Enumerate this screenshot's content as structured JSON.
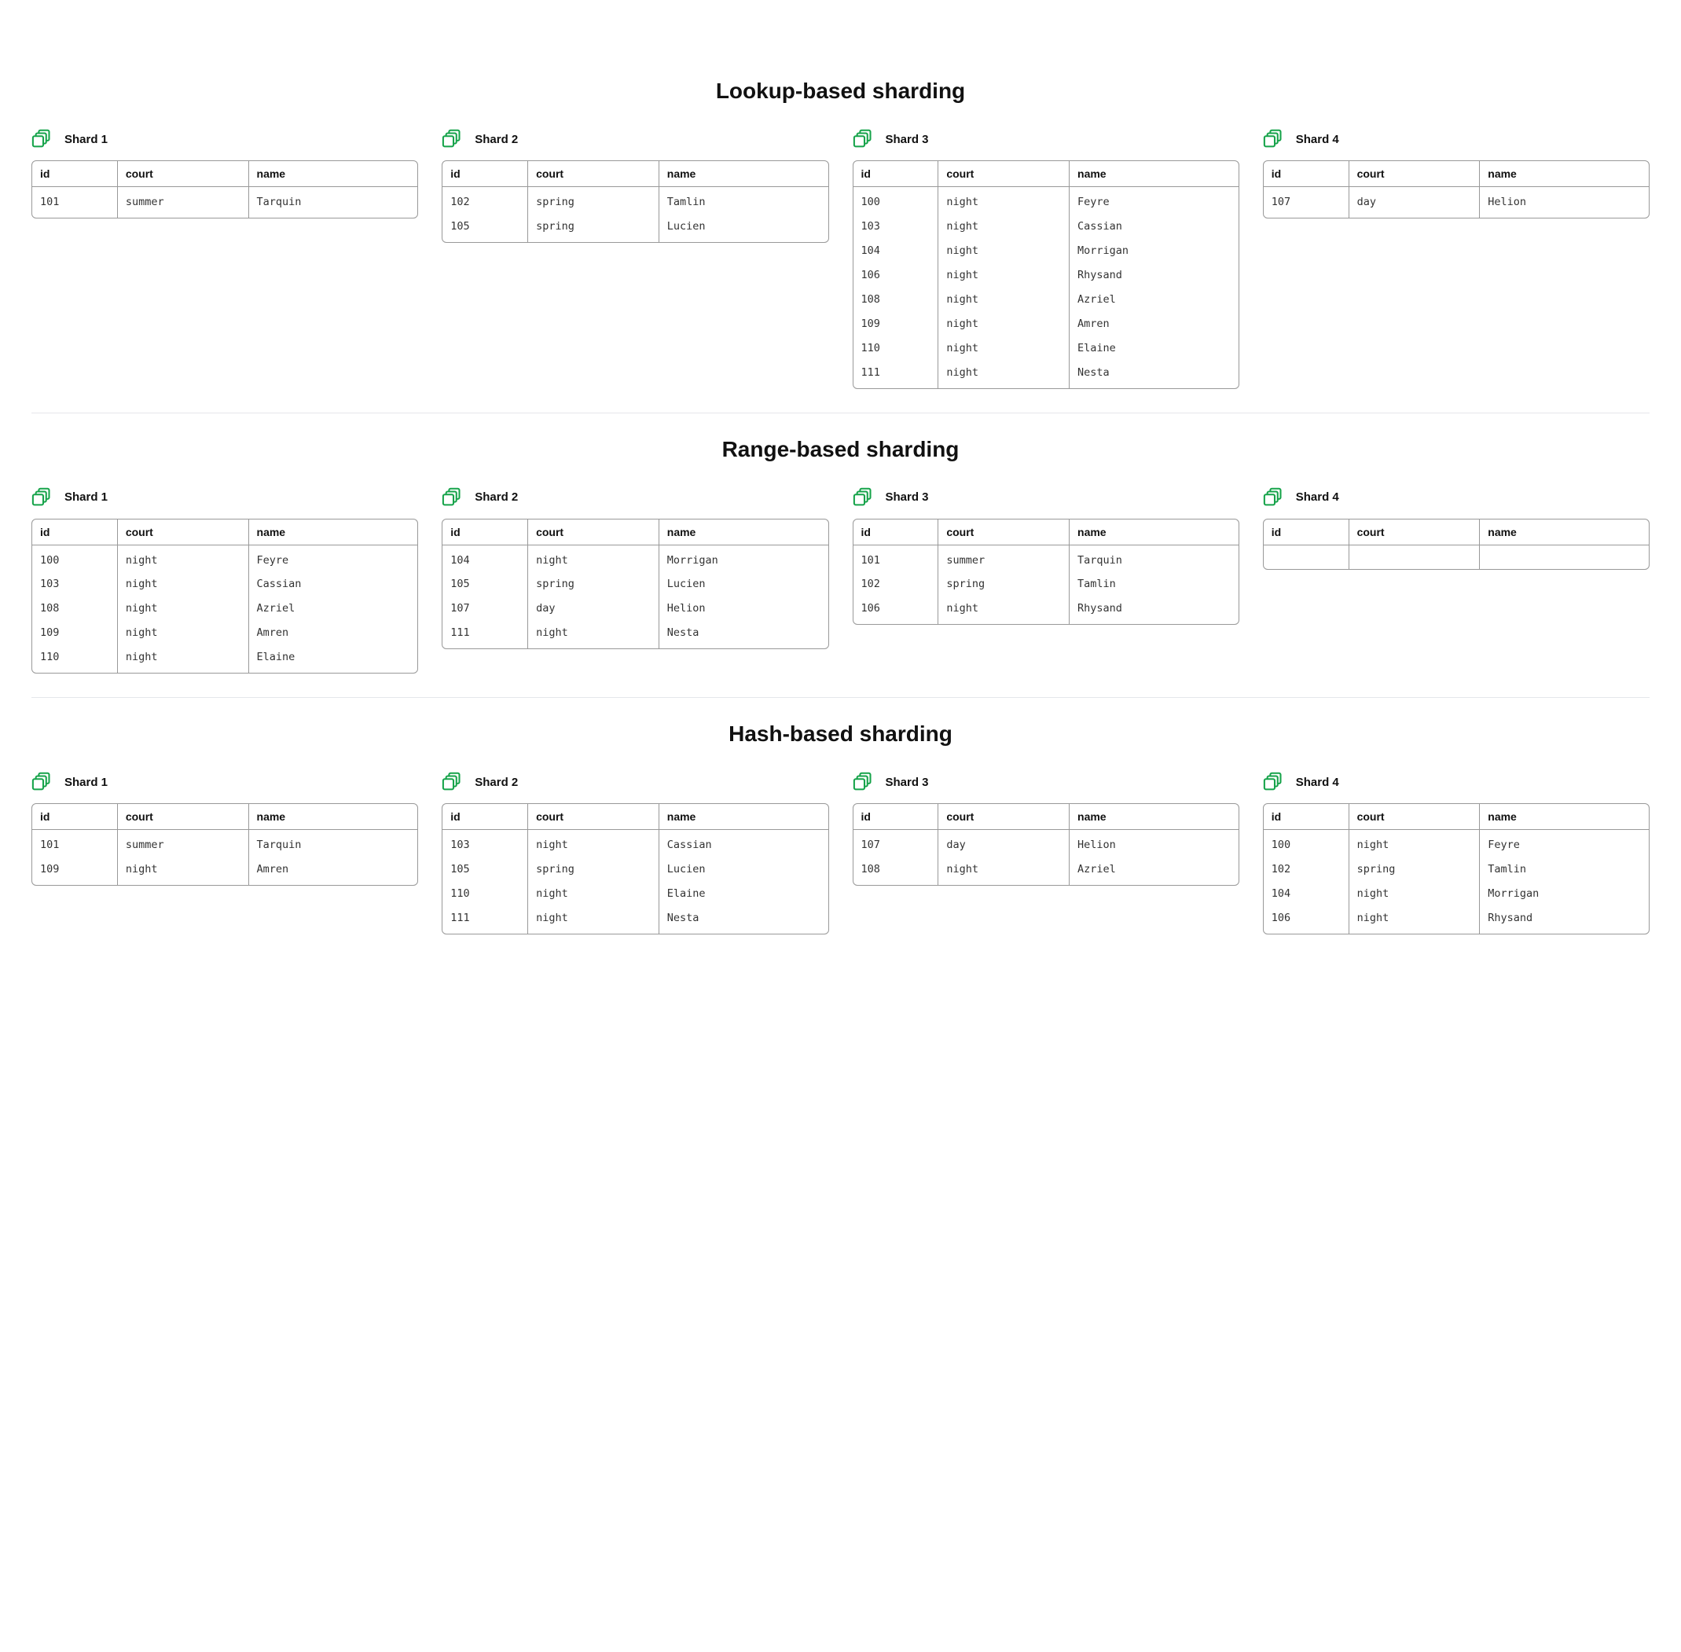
{
  "columns": {
    "id": "id",
    "court": "court",
    "name": "name"
  },
  "icon_name": "database-icon",
  "sections": [
    {
      "title": "Lookup-based sharding",
      "shards": [
        {
          "label": "Shard 1",
          "rows": [
            {
              "id": "101",
              "court": "summer",
              "name": "Tarquin"
            }
          ]
        },
        {
          "label": "Shard 2",
          "rows": [
            {
              "id": "102",
              "court": "spring",
              "name": "Tamlin"
            },
            {
              "id": "105",
              "court": "spring",
              "name": "Lucien"
            }
          ]
        },
        {
          "label": "Shard 3",
          "rows": [
            {
              "id": "100",
              "court": "night",
              "name": "Feyre"
            },
            {
              "id": "103",
              "court": "night",
              "name": "Cassian"
            },
            {
              "id": "104",
              "court": "night",
              "name": "Morrigan"
            },
            {
              "id": "106",
              "court": "night",
              "name": "Rhysand"
            },
            {
              "id": "108",
              "court": "night",
              "name": "Azriel"
            },
            {
              "id": "109",
              "court": "night",
              "name": "Amren"
            },
            {
              "id": "110",
              "court": "night",
              "name": "Elaine"
            },
            {
              "id": "111",
              "court": "night",
              "name": "Nesta"
            }
          ]
        },
        {
          "label": "Shard 4",
          "rows": [
            {
              "id": "107",
              "court": "day",
              "name": "Helion"
            }
          ]
        }
      ]
    },
    {
      "title": "Range-based sharding",
      "shards": [
        {
          "label": "Shard 1",
          "rows": [
            {
              "id": "100",
              "court": "night",
              "name": "Feyre"
            },
            {
              "id": "103",
              "court": "night",
              "name": "Cassian"
            },
            {
              "id": "108",
              "court": "night",
              "name": "Azriel"
            },
            {
              "id": "109",
              "court": "night",
              "name": "Amren"
            },
            {
              "id": "110",
              "court": "night",
              "name": "Elaine"
            }
          ]
        },
        {
          "label": "Shard 2",
          "rows": [
            {
              "id": "104",
              "court": "night",
              "name": "Morrigan"
            },
            {
              "id": "105",
              "court": "spring",
              "name": "Lucien"
            },
            {
              "id": "107",
              "court": "day",
              "name": "Helion"
            },
            {
              "id": "111",
              "court": "night",
              "name": "Nesta"
            }
          ]
        },
        {
          "label": "Shard 3",
          "rows": [
            {
              "id": "101",
              "court": "summer",
              "name": "Tarquin"
            },
            {
              "id": "102",
              "court": "spring",
              "name": "Tamlin"
            },
            {
              "id": "106",
              "court": "night",
              "name": "Rhysand"
            }
          ]
        },
        {
          "label": "Shard 4",
          "rows": []
        }
      ]
    },
    {
      "title": "Hash-based sharding",
      "shards": [
        {
          "label": "Shard 1",
          "rows": [
            {
              "id": "101",
              "court": "summer",
              "name": "Tarquin"
            },
            {
              "id": "109",
              "court": "night",
              "name": "Amren"
            }
          ]
        },
        {
          "label": "Shard 2",
          "rows": [
            {
              "id": "103",
              "court": "night",
              "name": "Cassian"
            },
            {
              "id": "105",
              "court": "spring",
              "name": "Lucien"
            },
            {
              "id": "110",
              "court": "night",
              "name": "Elaine"
            },
            {
              "id": "111",
              "court": "night",
              "name": "Nesta"
            }
          ]
        },
        {
          "label": "Shard 3",
          "rows": [
            {
              "id": "107",
              "court": "day",
              "name": "Helion"
            },
            {
              "id": "108",
              "court": "night",
              "name": "Azriel"
            }
          ]
        },
        {
          "label": "Shard 4",
          "rows": [
            {
              "id": "100",
              "court": "night",
              "name": "Feyre"
            },
            {
              "id": "102",
              "court": "spring",
              "name": "Tamlin"
            },
            {
              "id": "104",
              "court": "night",
              "name": "Morrigan"
            },
            {
              "id": "106",
              "court": "night",
              "name": "Rhysand"
            }
          ]
        }
      ]
    }
  ]
}
